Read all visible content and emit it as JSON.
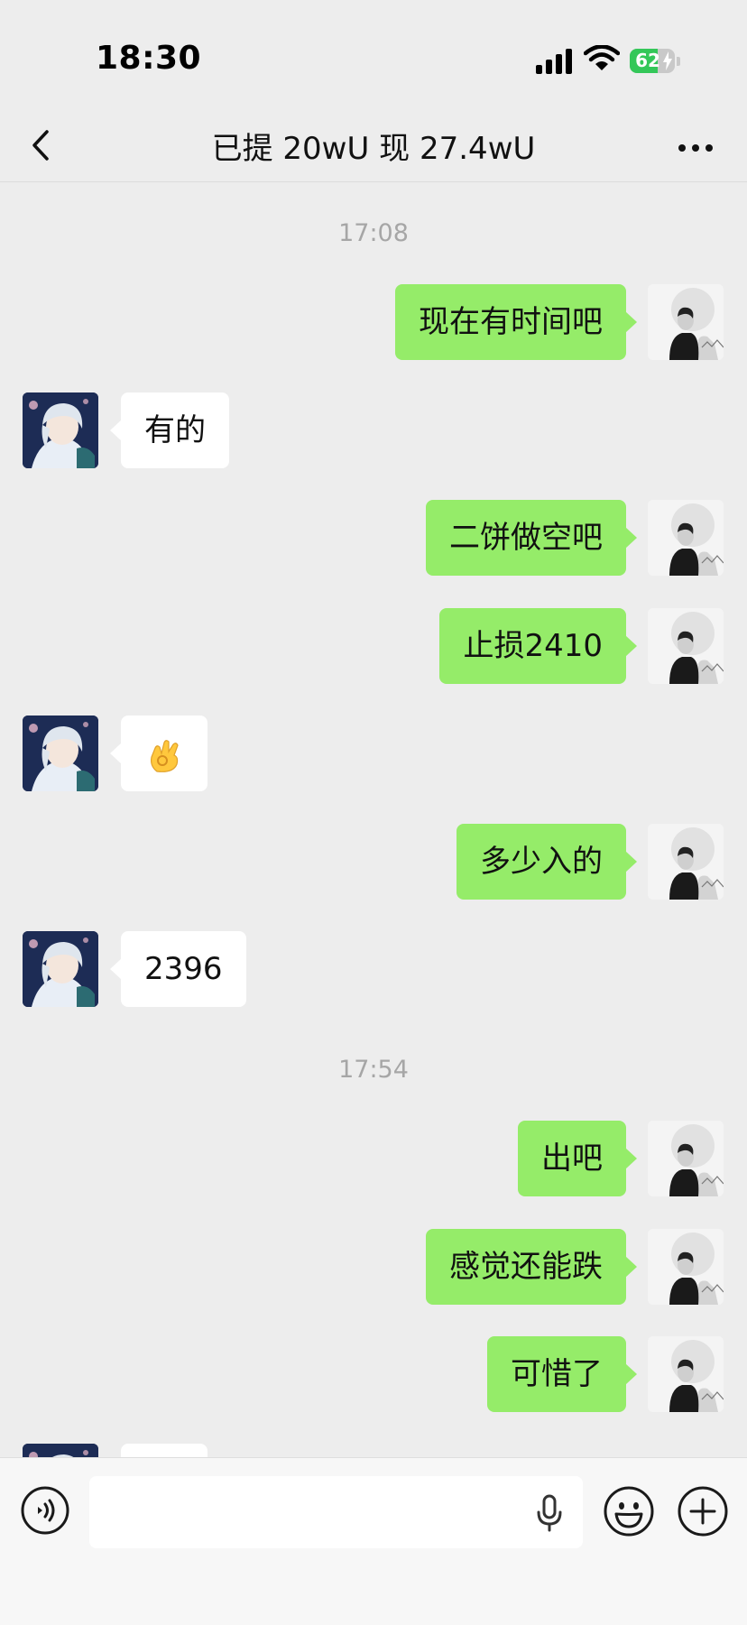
{
  "status_bar": {
    "time": "18:30",
    "battery": "62",
    "battery_level": 0.62
  },
  "nav": {
    "title": "已提 20wU 现 27.4wU",
    "back_icon": "chevron-left-icon",
    "more_icon": "more-dots-icon"
  },
  "chat": {
    "time_1": "17:08",
    "time_2": "17:54",
    "messages": [
      {
        "from": "me",
        "text": "现在有时间吧"
      },
      {
        "from": "other",
        "text": "有的"
      },
      {
        "from": "me",
        "text": "二饼做空吧"
      },
      {
        "from": "me",
        "text": "止损2410"
      },
      {
        "from": "other",
        "text": "",
        "emoji": "ok-hand-emoji"
      },
      {
        "from": "me",
        "text": "多少入的"
      },
      {
        "from": "other",
        "text": "2396"
      },
      {
        "from": "me",
        "text": "出吧"
      },
      {
        "from": "me",
        "text": "感觉还能跌"
      },
      {
        "from": "me",
        "text": "可惜了"
      }
    ]
  },
  "input_bar": {
    "value": "",
    "placeholder": "",
    "voice_icon": "voice-icon",
    "mic_icon": "mic-icon",
    "emoji_icon": "emoji-icon",
    "plus_icon": "plus-icon"
  },
  "colors": {
    "background": "#ededed",
    "my_bubble": "#95ec69",
    "other_bubble": "#ffffff",
    "battery_green": "#34c759"
  }
}
